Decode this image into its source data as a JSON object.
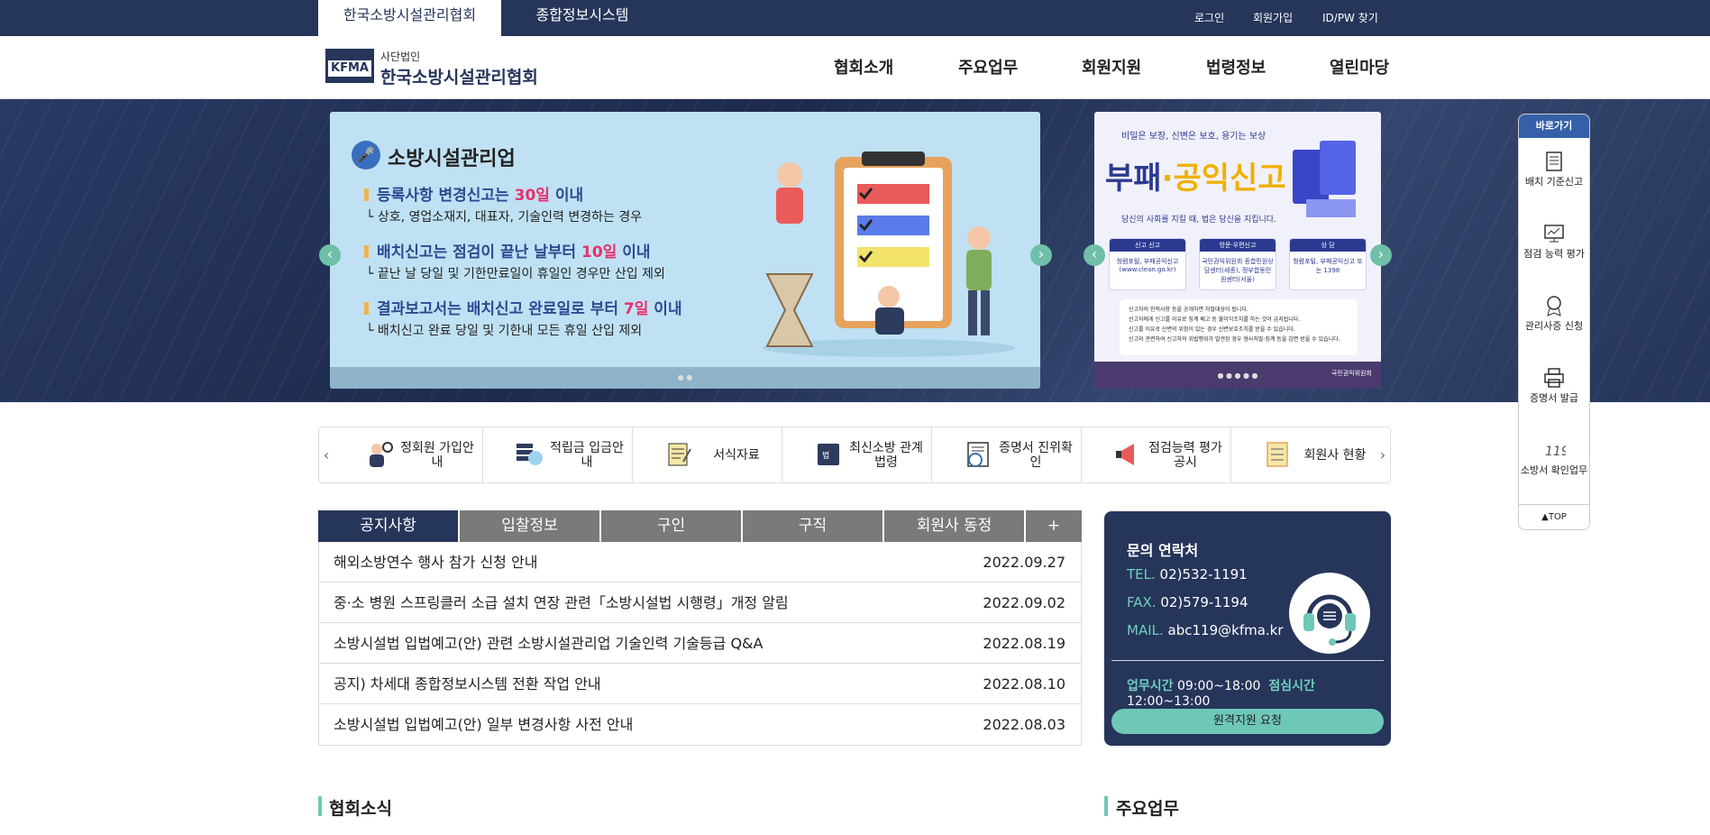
{
  "topbar": {
    "tab_active": "한국소방시설관리협회",
    "tab_other": "종합정보시스템",
    "links": [
      "로그인",
      "회원가입",
      "ID/PW 찾기"
    ]
  },
  "header": {
    "logo_text": "KFMA",
    "logo_sub": "사단법인",
    "logo_title": "한국소방시설관리협회",
    "nav": [
      "협회소개",
      "주요업무",
      "회원지원",
      "법령정보",
      "열린마당"
    ]
  },
  "slide1": {
    "title": "소방시설관리업",
    "items": [
      {
        "pre": "등록사항 변경신고는 ",
        "em": "30일",
        "post": " 이내",
        "desc": "상호, 영업소재지, 대표자, 기술인력 변경하는 경우"
      },
      {
        "pre": "배치신고는 점검이 끝난 날부터 ",
        "em": "10일",
        "post": " 이내",
        "desc": "끝난 날 당일 및 기한만료일이 휴일인 경우만 산입 제외"
      },
      {
        "pre": "결과보고서는 배치신고 완료일로 부터 ",
        "em": "7일",
        "post": " 이내",
        "desc": "배치신고 완료 당일 및 기한내 모든 휴일 산입 제외"
      }
    ]
  },
  "slide2": {
    "top": "비밀은 보장, 신변은 보호, 용기는 보상",
    "title_a": "부패",
    "title_b": "·공익신고",
    "sub": "당신의 사회를 지킬 때, 법은 당신을 지킵니다.",
    "cards": [
      {
        "head": "신고 신고",
        "body": "청렴포털, 부패공익신고 (www.clean.go.kr)"
      },
      {
        "head": "방문·우편신고",
        "body": "국민권익위원회 종합민원상담센터(세종), 정부합동민원센터(서울)"
      },
      {
        "head": "상 담",
        "body": "청렴포털, 부패공익신고 또는 1398"
      }
    ],
    "notes": [
      "신고자의 인적사항 등을 공개하면 처벌대상이 됩니다.",
      "신고자에게 신고를 이유로 징계 배고 등 불이익조치를 하는 것이 금지됩니다.",
      "신고를 이유로 신변의 위험이 있는 경우 신변보호조치를 받을 수 있습니다.",
      "신고와 관련하여 신고자의 위법행위가 발견된 경우 형사처벌·징계 등을 감면 받을 수 있습니다."
    ],
    "footer": "국민권익위원회"
  },
  "quick": {
    "head": "바로가기",
    "items": [
      "배치 기준신고",
      "점검 능력 평가",
      "관리사증 신청",
      "증명서 발급",
      "소방서 확인업무"
    ],
    "top": "▲TOP"
  },
  "icons_row": {
    "items": [
      {
        "label": "정회원 가입안내",
        "icon": "member-icon"
      },
      {
        "label": "적립금 입금안내",
        "icon": "coin-icon"
      },
      {
        "label": "서식자료",
        "icon": "form-icon"
      },
      {
        "label": "최신소방 관계법령",
        "icon": "law-book-icon"
      },
      {
        "label": "증명서 진위확인",
        "icon": "certificate-icon"
      },
      {
        "label": "점검능력 평가공시",
        "icon": "megaphone-icon"
      },
      {
        "label": "회원사 현황",
        "icon": "checklist-icon"
      }
    ]
  },
  "notice": {
    "tabs": [
      "공지사항",
      "입찰정보",
      "구인",
      "구직",
      "회원사 동정",
      "+"
    ],
    "rows": [
      {
        "title": "해외소방연수 행사 참가 신청 안내",
        "date": "2022.09.27"
      },
      {
        "title": "중·소 병원 스프링클러 소급 설치 연장 관련「소방시설법 시행령」개정 알림",
        "date": "2022.09.02"
      },
      {
        "title": "소방시설법 입법예고(안) 관련 소방시설관리업 기술인력 기술등급 Q&A",
        "date": "2022.08.19"
      },
      {
        "title": "공지) 차세대 종합정보시스템 전환 작업 안내",
        "date": "2022.08.10"
      },
      {
        "title": "소방시설법 입법예고(안) 일부 변경사항 사전 안내",
        "date": "2022.08.03"
      }
    ]
  },
  "contact": {
    "title": "문의 연락처",
    "tel_label": "TEL.",
    "tel": "02)532-1191",
    "fax_label": "FAX.",
    "fax": "02)579-1194",
    "mail_label": "MAIL.",
    "mail": "abc119@kfma.kr",
    "work_label": "업무시간",
    "work": "09:00~18:00",
    "lunch_label": "점심시간",
    "lunch": "12:00~13:00",
    "button": "원격지원 요청"
  },
  "sections": [
    "협회소식",
    "주요업무"
  ],
  "colors": {
    "navy": "#26355a",
    "mint": "#6fc7b8",
    "accent_red": "#e8306a"
  }
}
